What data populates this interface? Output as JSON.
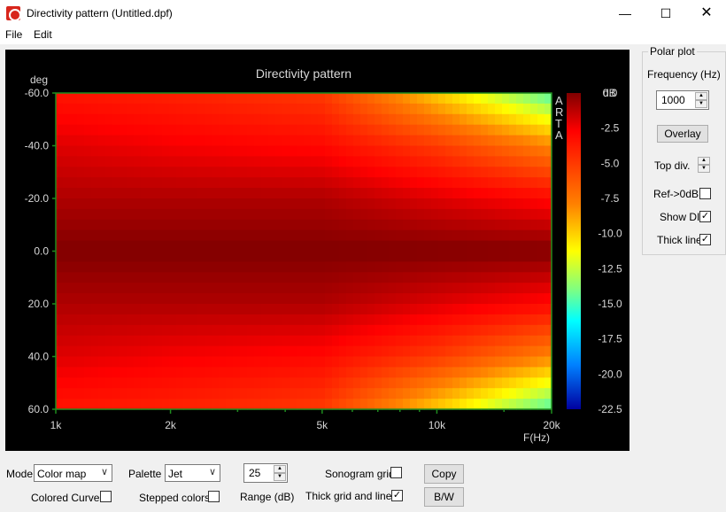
{
  "window": {
    "title": "Directivity pattern (Untitled.dpf)"
  },
  "menu": {
    "file": "File",
    "edit": "Edit"
  },
  "plot": {
    "title": "Directivity pattern",
    "y_unit": "deg",
    "x_unit": "F(Hz)",
    "brand": "ARTA",
    "y_ticks": [
      "-60.0",
      "-40.0",
      "-20.0",
      "0.0",
      "20.0",
      "40.0",
      "60.0"
    ],
    "x_ticks": [
      "1k",
      "2k",
      "5k",
      "10k",
      "20k"
    ],
    "colorbar_unit": "dB",
    "colorbar_ticks": [
      "0.0",
      "-2.5",
      "-5.0",
      "-7.5",
      "-10.0",
      "-12.5",
      "-15.0",
      "-17.5",
      "-20.0",
      "-22.5"
    ]
  },
  "chart_data": {
    "type": "heatmap",
    "title": "Directivity pattern",
    "xlabel": "F(Hz)",
    "ylabel": "deg",
    "x_scale": "log",
    "xlim": [
      1000,
      20000
    ],
    "ylim": [
      -60,
      60
    ],
    "zlabel": "dB",
    "zlim": [
      -22.5,
      0
    ],
    "palette": "Jet",
    "x": [
      1000,
      2000,
      5000,
      10000,
      20000
    ],
    "y": [
      -60,
      -40,
      -20,
      0,
      20,
      40,
      60
    ],
    "values": [
      [
        -3.5,
        -4.0,
        -5.0,
        -10.0,
        -15.0
      ],
      [
        -2.0,
        -2.5,
        -3.0,
        -5.0,
        -8.0
      ],
      [
        -1.0,
        -1.0,
        -1.0,
        -2.0,
        -3.0
      ],
      [
        0.0,
        0.0,
        0.0,
        0.0,
        0.0
      ],
      [
        -1.0,
        -1.0,
        -1.0,
        -2.0,
        -3.0
      ],
      [
        -2.0,
        -2.5,
        -3.0,
        -5.0,
        -8.0
      ],
      [
        -3.5,
        -4.0,
        -5.0,
        -10.0,
        -15.0
      ]
    ]
  },
  "polar": {
    "group_title": "Polar plot",
    "frequency_label": "Frequency (Hz)",
    "frequency_value": "1000",
    "overlay_label": "Overlay",
    "top_div_label": "Top div.",
    "ref_label": "Ref->0dB",
    "ref_checked": false,
    "show_di_label": "Show DI",
    "show_di_checked": true,
    "thick_line_label": "Thick line",
    "thick_line_checked": true
  },
  "bottom": {
    "mode_label": "Mode",
    "mode_value": "Color map",
    "palette_label": "Palette",
    "palette_value": "Jet",
    "range_value": "25",
    "range_label": "Range (dB)",
    "sonogram_grid_label": "Sonogram grid",
    "sonogram_grid_checked": false,
    "colored_curves_label": "Colored Curves",
    "colored_curves_checked": false,
    "stepped_colors_label": "Stepped colors",
    "stepped_colors_checked": false,
    "thick_grid_label": "Thick grid and  lines",
    "thick_grid_checked": true,
    "copy_label": "Copy",
    "bw_label": "B/W"
  }
}
